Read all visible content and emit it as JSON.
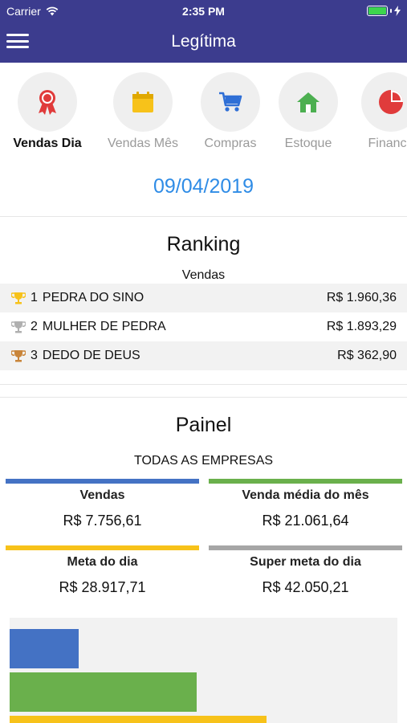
{
  "status": {
    "carrier": "Carrier",
    "time": "2:35 PM"
  },
  "header": {
    "title": "Legítima"
  },
  "tabs": [
    {
      "label": "Vendas Dia",
      "icon": "award-ribbon-icon",
      "active": true
    },
    {
      "label": "Vendas Mês",
      "icon": "calendar-icon",
      "active": false
    },
    {
      "label": "Compras",
      "icon": "shopping-cart-icon",
      "active": false
    },
    {
      "label": "Estoque",
      "icon": "home-icon",
      "active": false
    },
    {
      "label": "Finance",
      "icon": "pie-chart-icon",
      "active": false
    }
  ],
  "date": "09/04/2019",
  "ranking": {
    "title": "Ranking",
    "subtitle": "Vendas",
    "rows": [
      {
        "pos": "1",
        "name": "PEDRA DO SINO",
        "value": "R$ 1.960,36",
        "medal": "gold"
      },
      {
        "pos": "2",
        "name": "MULHER DE PEDRA",
        "value": "R$ 1.893,29",
        "medal": "silver"
      },
      {
        "pos": "3",
        "name": "DEDO DE DEUS",
        "value": "R$ 362,90",
        "medal": "bronze"
      }
    ]
  },
  "painel": {
    "title": "Painel",
    "subtitle": "TODAS AS EMPRESAS",
    "cards": [
      {
        "title": "Vendas",
        "value": "R$ 7.756,61",
        "color": "#4472c4"
      },
      {
        "title": "Venda média do mês",
        "value": "R$ 21.061,64",
        "color": "#6ab04c"
      },
      {
        "title": "Meta do dia",
        "value": "R$ 28.917,71",
        "color": "#f7c21a"
      },
      {
        "title": "Super meta do dia",
        "value": "R$ 42.050,21",
        "color": "#a6a6a6"
      }
    ]
  },
  "colors": {
    "nav": "#3c3c8e",
    "date": "#2f8ce6",
    "gold": "#f7c21a",
    "silver": "#b0b0b0",
    "bronze": "#c9853a"
  }
}
